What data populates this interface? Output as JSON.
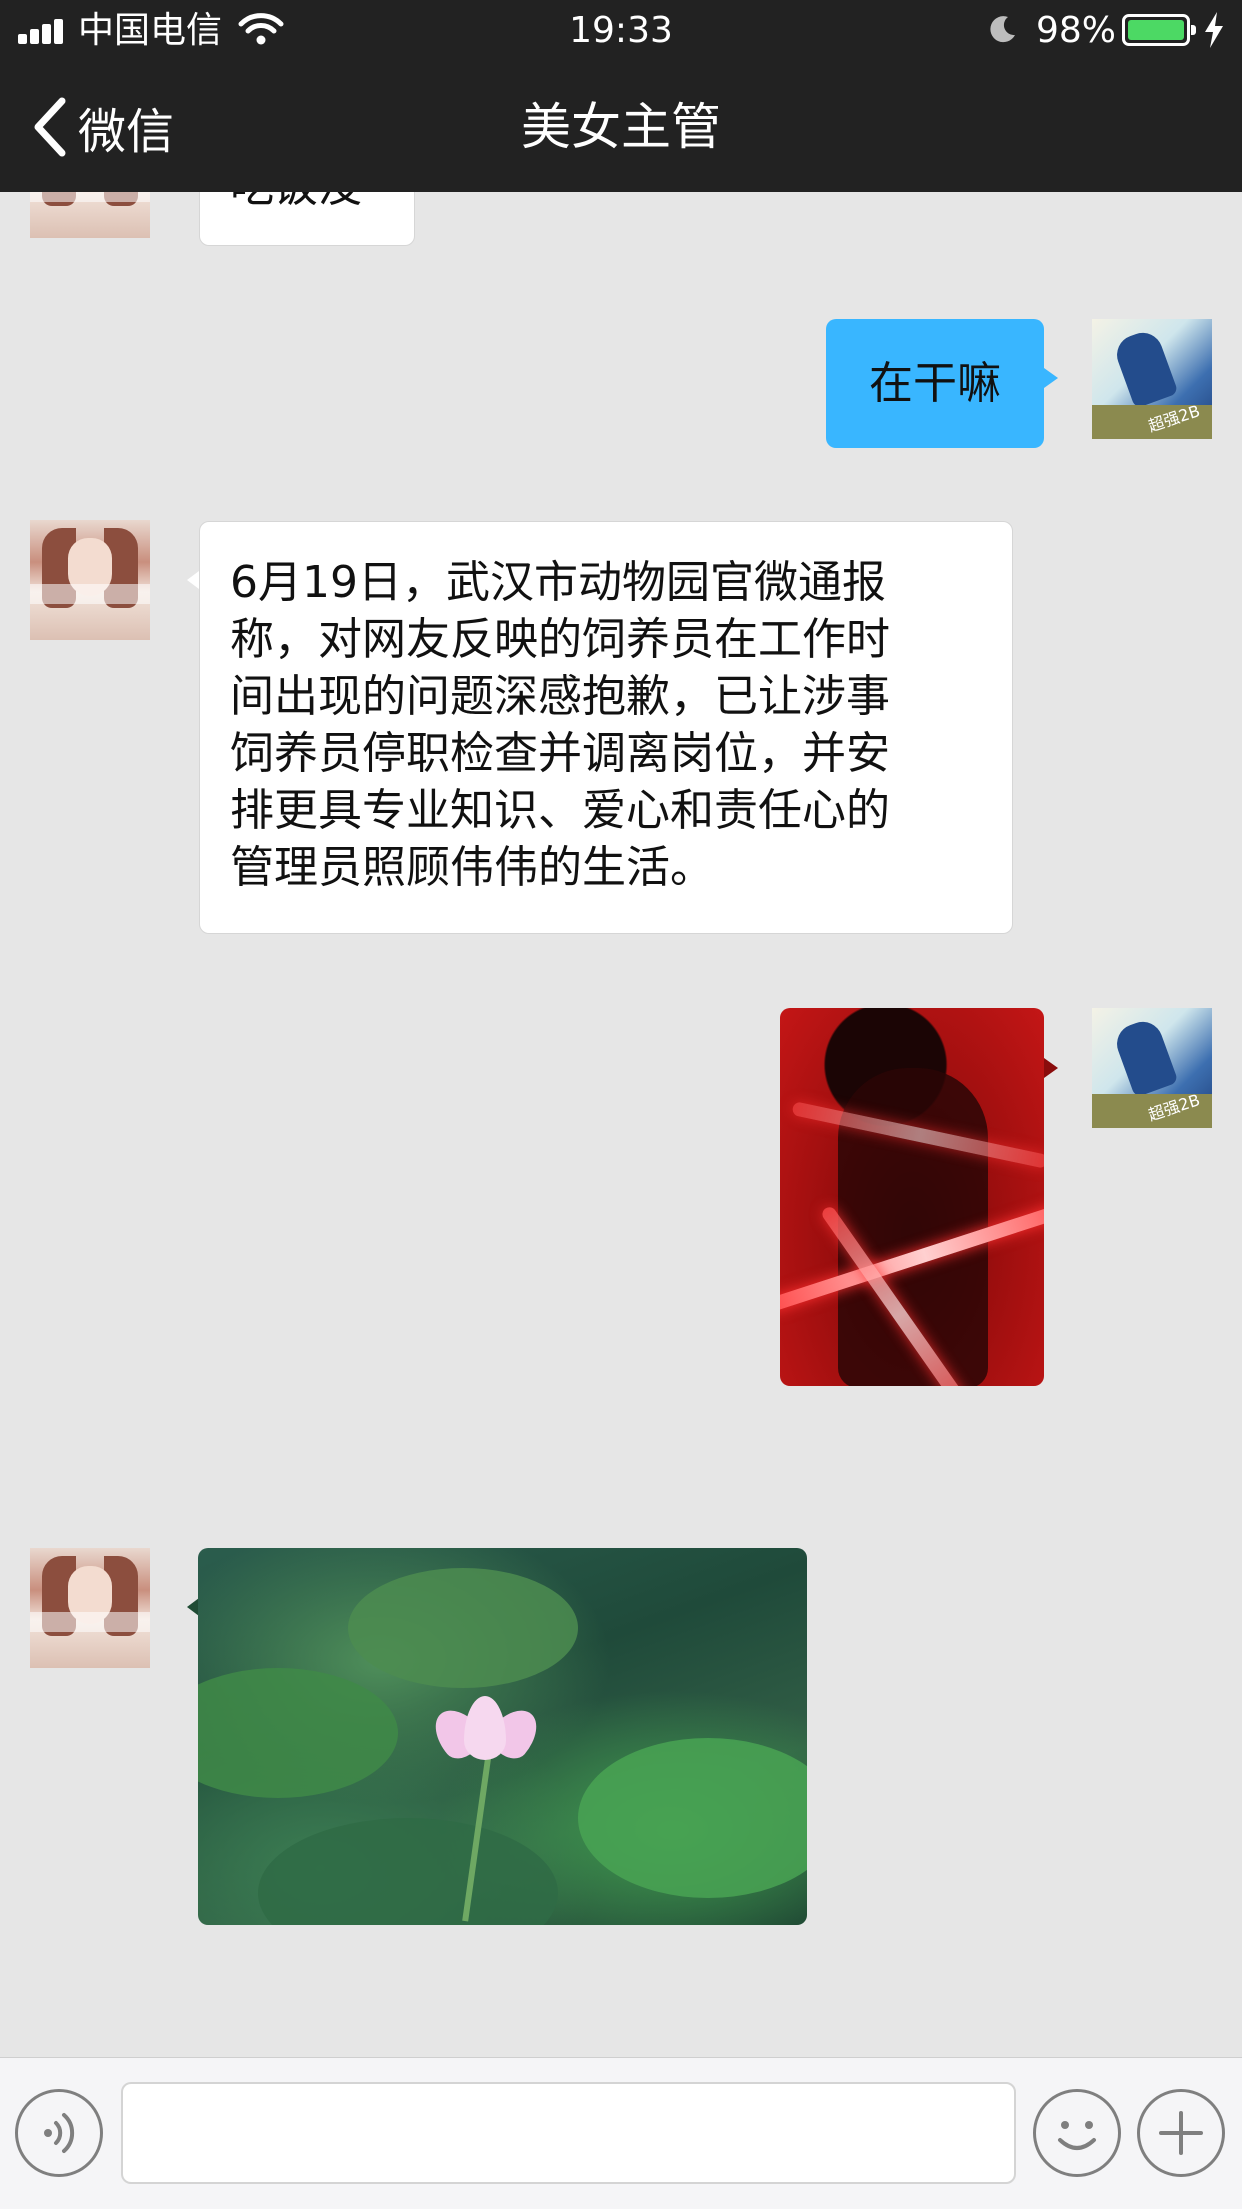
{
  "status_bar": {
    "carrier": "中国电信",
    "time": "19:33",
    "battery_percent": "98%",
    "battery_level": 0.98,
    "battery_color": "#4cd964"
  },
  "nav": {
    "back_label": "微信",
    "title": "美女主管"
  },
  "messages": [
    {
      "side": "incoming",
      "type": "text",
      "text": "吃饭没",
      "avatar": "girl-avatar"
    },
    {
      "side": "outgoing",
      "type": "text",
      "text": "在干嘛",
      "avatar": "boy-avatar"
    },
    {
      "side": "incoming",
      "type": "text",
      "lines": [
        "6月19日，武汉市动物园官微通报",
        "称，对网友反映的饲养员在工作时",
        "间出现的问题深感抱歉，已让涉事",
        "饲养员停职检查并调离岗位，并安",
        "排更具专业知识、爱心和责任心的",
        "管理员照顾伟伟的生活。"
      ],
      "avatar": "girl-avatar"
    },
    {
      "side": "outgoing",
      "type": "image",
      "image": "red-portrait-photo",
      "avatar": "boy-avatar"
    },
    {
      "side": "incoming",
      "type": "image",
      "image": "lotus-flower-photo",
      "avatar": "girl-avatar"
    }
  ],
  "input_bar": {
    "voice_icon": "voice-icon",
    "emoji_icon": "emoji-icon",
    "plus_icon": "plus-icon",
    "input_value": ""
  },
  "colors": {
    "nav_background": "#222222",
    "chat_background": "#e6e6e6",
    "outgoing_bubble": "#39b6ff",
    "incoming_bubble": "#ffffff"
  }
}
